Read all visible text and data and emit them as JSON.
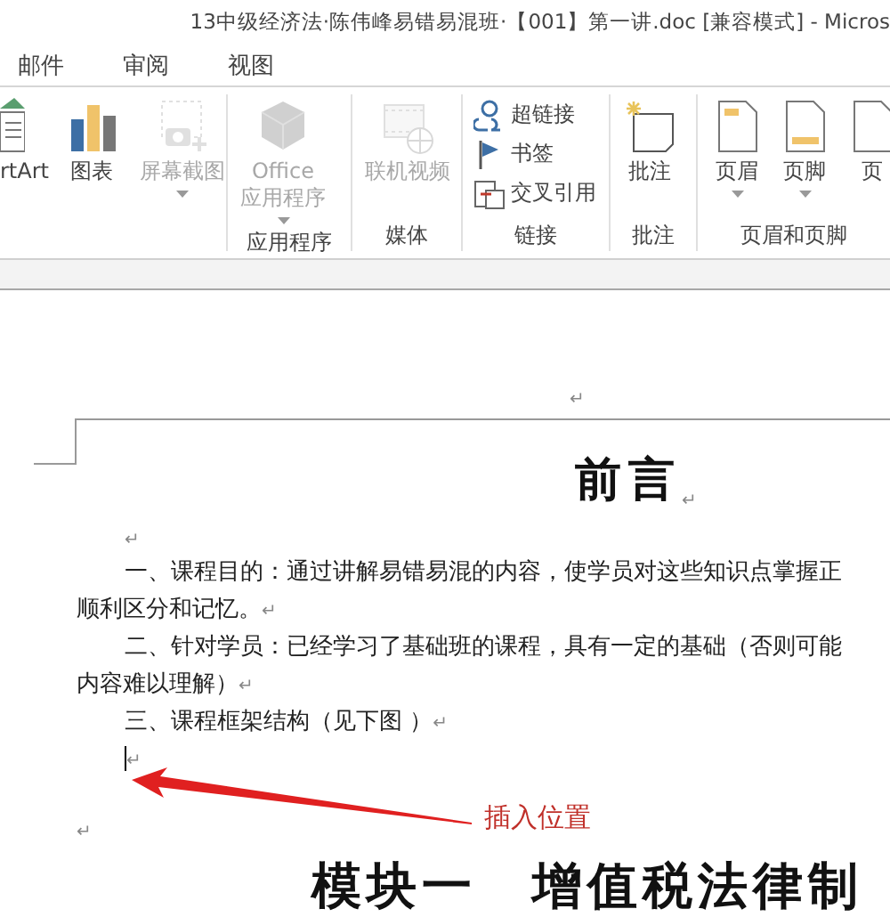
{
  "window": {
    "title": "13中级经济法·陈伟峰易错易混班·【001】第一讲.doc [兼容模式] - Micros"
  },
  "menu_tabs": [
    {
      "label": "邮件"
    },
    {
      "label": "审阅"
    },
    {
      "label": "视图"
    }
  ],
  "ribbon": {
    "groups": [
      {
        "items": [
          {
            "kind": "large",
            "lines": [
              "rtArt"
            ],
            "disabled": false,
            "dropdown": false
          },
          {
            "kind": "large",
            "lines": [
              "图表"
            ],
            "disabled": false,
            "dropdown": false
          },
          {
            "kind": "large",
            "lines": [
              "屏幕截图"
            ],
            "disabled": true,
            "dropdown": true
          }
        ]
      },
      {
        "label": "应用程序",
        "items": [
          {
            "kind": "large",
            "lines": [
              "Office",
              "应用程序"
            ],
            "disabled": true,
            "dropdown": true
          }
        ]
      },
      {
        "label": "媒体",
        "items": [
          {
            "kind": "large",
            "lines": [
              "联机视频"
            ],
            "disabled": true,
            "dropdown": false
          }
        ]
      },
      {
        "label": "链接",
        "items": [
          {
            "kind": "small",
            "lines": [
              "超链接"
            ],
            "disabled": false,
            "dropdown": false
          },
          {
            "kind": "small",
            "lines": [
              "书签"
            ],
            "disabled": false,
            "dropdown": false
          },
          {
            "kind": "small",
            "lines": [
              "交叉引用"
            ],
            "disabled": false,
            "dropdown": false
          }
        ]
      },
      {
        "label": "批注",
        "items": [
          {
            "kind": "large",
            "lines": [
              "批注"
            ],
            "disabled": false,
            "dropdown": false
          }
        ]
      },
      {
        "label": "页眉和页脚",
        "items": [
          {
            "kind": "large",
            "lines": [
              "页眉"
            ],
            "disabled": false,
            "dropdown": true
          },
          {
            "kind": "large",
            "lines": [
              "页脚"
            ],
            "disabled": false,
            "dropdown": true
          },
          {
            "kind": "large",
            "lines": [
              "页"
            ],
            "disabled": false,
            "dropdown": false
          }
        ]
      }
    ]
  },
  "document": {
    "header_mark": "↵",
    "title": "前言",
    "title_mark": "↵",
    "paragraphs": [
      {
        "kind": "indented",
        "mark": "↵",
        "cursor": false
      },
      {
        "kind": "indented",
        "lines": [
          "一、课程目的：通过讲解易错易混的内容，使学员对这些知识点掌握正",
          "顺利区分和记忆。"
        ],
        "mark": "↵",
        "cursor": false
      },
      {
        "kind": "indented",
        "lines": [
          "二、针对学员：已经学习了基础班的课程，具有一定的基础（否则可能",
          "内容难以理解）"
        ],
        "mark": "↵",
        "cursor": false
      },
      {
        "kind": "indented",
        "lines": [
          "三、课程框架结构（见下图 ）"
        ],
        "mark": "↵",
        "cursor": false
      },
      {
        "kind": "indented",
        "mark": "↵",
        "cursor": true
      },
      {
        "kind": "plain",
        "mark": "↵",
        "cursor": false
      }
    ],
    "heading": "模块一　增值税法律制"
  },
  "callout": {
    "text": "插入位置"
  }
}
